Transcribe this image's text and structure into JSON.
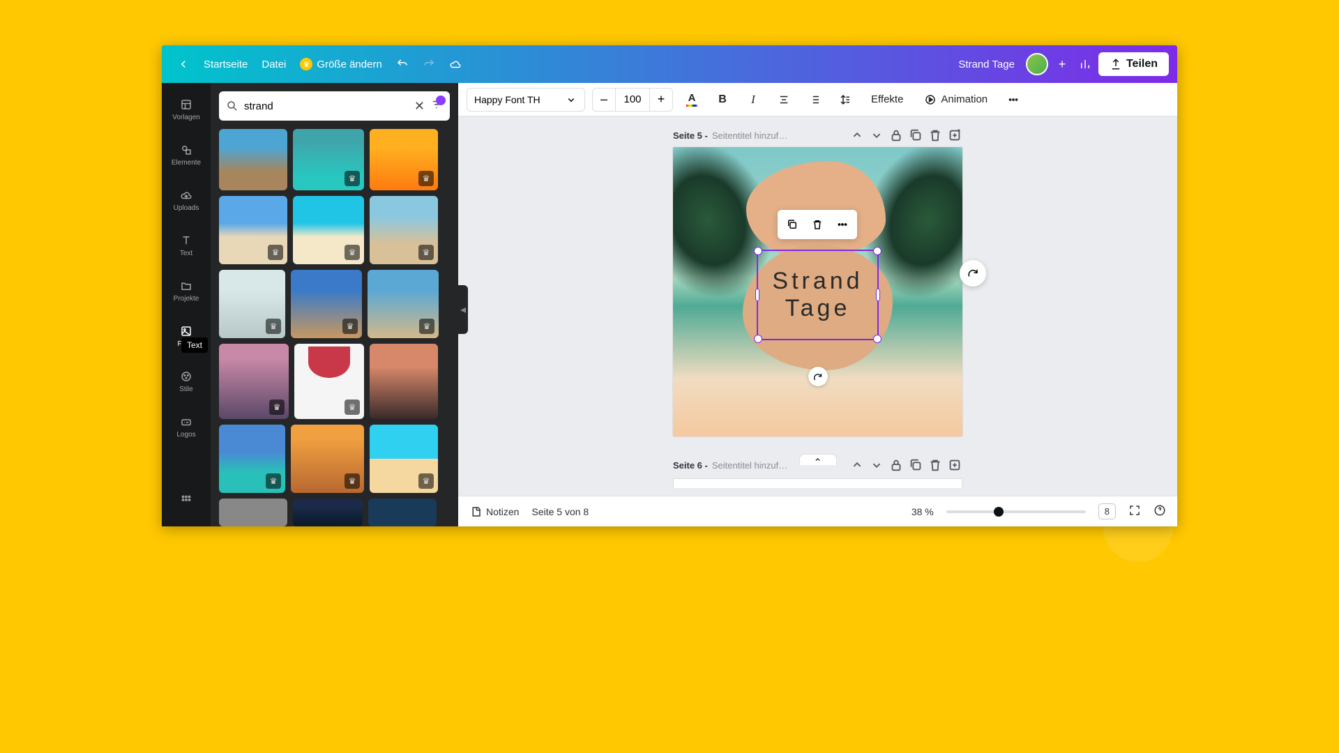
{
  "header": {
    "home": "Startseite",
    "file": "Datei",
    "resize": "Größe ändern",
    "doc_title": "Strand Tage",
    "share": "Teilen"
  },
  "rail": {
    "templates": "Vorlagen",
    "elements": "Elemente",
    "uploads": "Uploads",
    "text": "Text",
    "tooltip": "Text",
    "projects": "Projekte",
    "photos": "Fotos",
    "styles": "Stile",
    "logos": "Logos"
  },
  "search": {
    "value": "strand"
  },
  "toolbar": {
    "font": "Happy Font TH",
    "size": "100",
    "effects": "Effekte",
    "animation": "Animation"
  },
  "pages": {
    "p5_label": "Seite 5 -",
    "p5_hint": "Seitentitel hinzuf…",
    "p6_label": "Seite 6 -",
    "p6_hint": "Seitentitel hinzuf…"
  },
  "canvas": {
    "line1": "Strand",
    "line2": "Tage"
  },
  "footer": {
    "notes": "Notizen",
    "page_counter": "Seite 5 von 8",
    "zoom": "38 %",
    "pages_total": "8"
  }
}
